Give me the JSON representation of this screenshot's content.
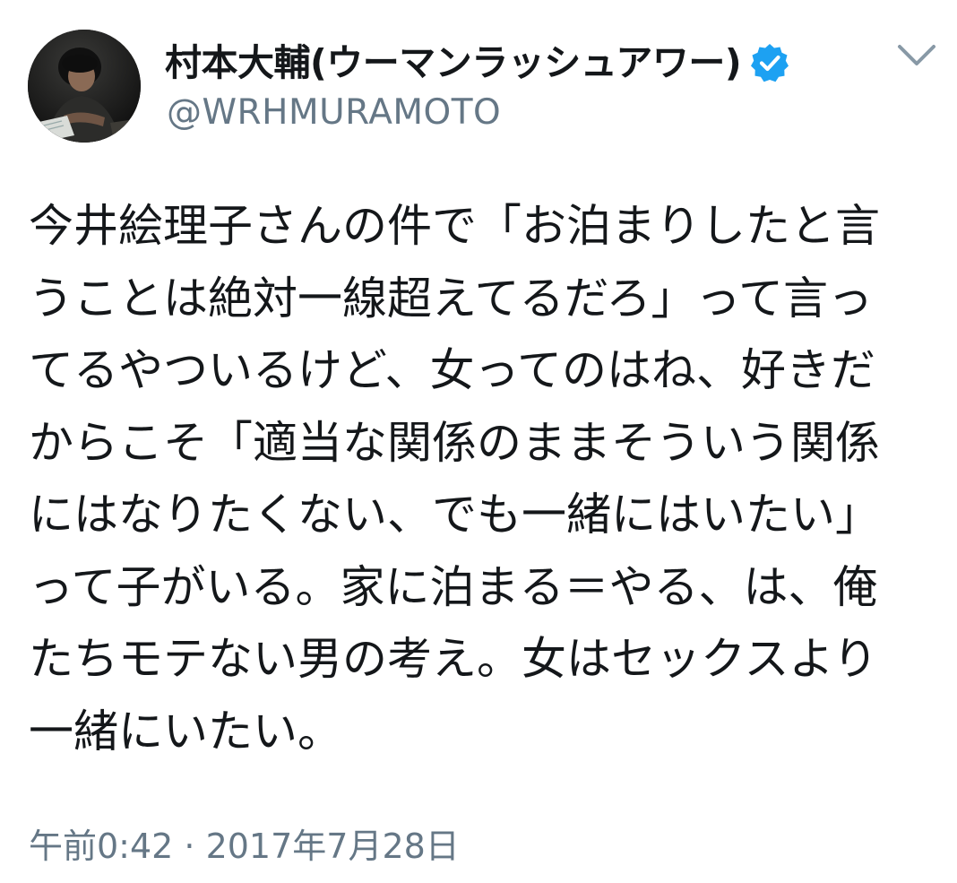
{
  "author": {
    "display_name": "村本大輔(ウーマンラッシュアワー)",
    "handle": "@WRHMURAMOTO",
    "verified": true,
    "avatar_icon": "profile-photo"
  },
  "menu": {
    "icon": "chevron-down-icon"
  },
  "tweet": {
    "lines": [
      "今井絵理子さんの件で「お泊まりしたと言",
      "うことは絶対一線超えてるだろ」って言っ",
      "てるやついるけど、女ってのはね、好きだ",
      "からこそ「適当な関係のままそういう関係",
      "にはなりたくない、でも一緒にはいたい」",
      "って子がいる。家に泊まる＝やる、は、俺",
      "たちモテない男の考え。女はセックスより",
      "一緒にいたい。"
    ],
    "timestamp": "午前0:42 · 2017年7月28日"
  },
  "colors": {
    "text": "#14171a",
    "secondary": "#657786",
    "verified_blue": "#1da1f2",
    "background": "#ffffff"
  }
}
